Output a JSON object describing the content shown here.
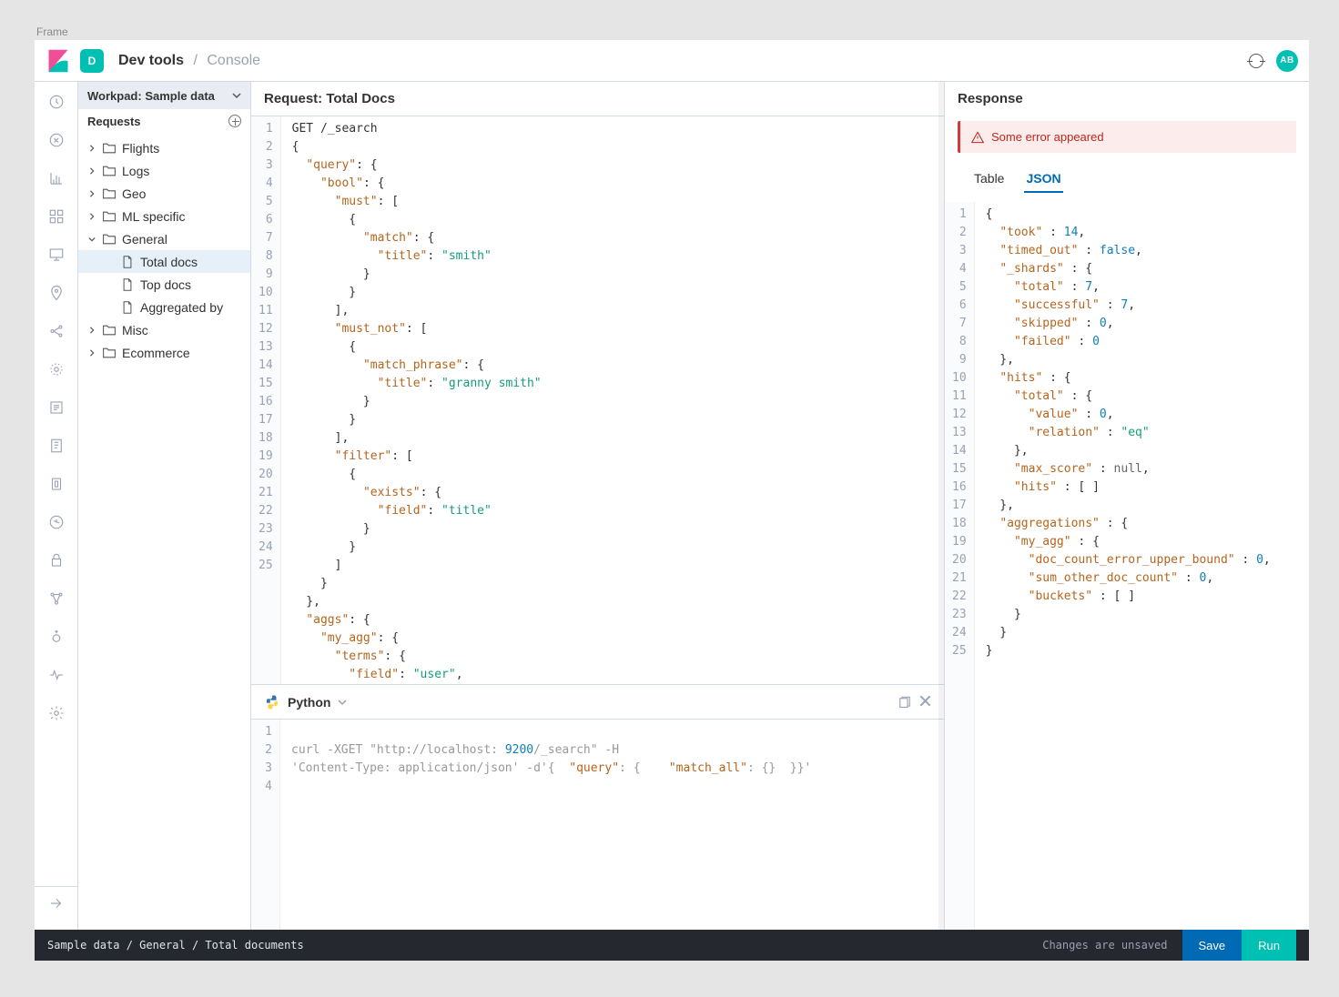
{
  "frame_label": "Frame",
  "header": {
    "d_badge": "D",
    "breadcrumb_app": "Dev tools",
    "breadcrumb_page": "Console",
    "avatar_initials": "AB"
  },
  "sidebar": {
    "workpad_label": "Workpad: Sample data",
    "requests_label": "Requests",
    "tree": {
      "flights": "Flights",
      "logs": "Logs",
      "geo": "Geo",
      "ml": "ML specific",
      "general": "General",
      "general_children": {
        "total_docs": "Total docs",
        "top_docs": "Top docs",
        "aggregated_by": "Aggregated by"
      },
      "misc": "Misc",
      "ecommerce": "Ecommerce"
    }
  },
  "request": {
    "title": "Request: Total Docs",
    "lines": [
      "GET /_search",
      "{",
      "  \"query\": {",
      "    \"bool\": {",
      "      \"must\": [",
      "        {",
      "          \"match\": {",
      "            \"title\": \"smith\"",
      "          }",
      "        }",
      "      ],",
      "      \"must_not\": [",
      "        {",
      "          \"match_phrase\": {",
      "            \"title\": \"granny smith\"",
      "          }",
      "        }",
      "      ],",
      "      \"filter\": [",
      "        {",
      "          \"exists\": {",
      "            \"field\": \"title\"",
      "          }",
      "        }",
      "      ]",
      "    }",
      "  },",
      "  \"aggs\": {",
      "    \"my_agg\": {",
      "      \"terms\": {",
      "        \"field\": \"user\","
    ]
  },
  "python": {
    "title": "Python",
    "lines": [
      "",
      "curl -XGET \"http://localhost:9200/_search\" -H",
      "'Content-Type: application/json' -d'{  \"query\": {    \"match_all\": {}  }}'",
      ""
    ]
  },
  "response": {
    "title": "Response",
    "error_text": "Some error appeared",
    "tabs": {
      "table": "Table",
      "json": "JSON"
    },
    "lines": [
      "{",
      "  \"took\" : 14,",
      "  \"timed_out\" : false,",
      "  \"_shards\" : {",
      "    \"total\" : 7,",
      "    \"successful\" : 7,",
      "    \"skipped\" : 0,",
      "    \"failed\" : 0",
      "  },",
      "  \"hits\" : {",
      "    \"total\" : {",
      "      \"value\" : 0,",
      "      \"relation\" : \"eq\"",
      "    },",
      "    \"max_score\" : null,",
      "    \"hits\" : [ ]",
      "  },",
      "  \"aggregations\" : {",
      "    \"my_agg\" : {",
      "      \"doc_count_error_upper_bound\" : 0,",
      "      \"sum_other_doc_count\" : 0,",
      "      \"buckets\" : [ ]",
      "    }",
      "  }",
      "}"
    ]
  },
  "footer": {
    "path": "Sample data / General / Total documents",
    "status": "Changes are unsaved",
    "save": "Save",
    "run": "Run"
  }
}
